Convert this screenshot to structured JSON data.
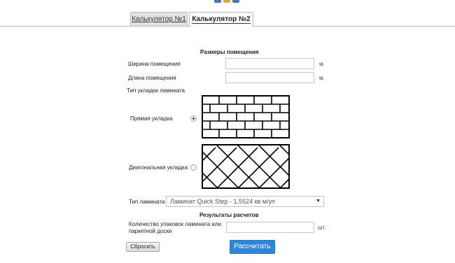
{
  "colors": {
    "accent": "#2d86d8",
    "tab_inactive": "#e3e3e3",
    "border": "#b9b9b9"
  },
  "tabs": [
    {
      "label": "Калькулятор №1",
      "active": false
    },
    {
      "label": "Калькулятор №2",
      "active": true
    }
  ],
  "room": {
    "title": "Размеры помещения",
    "width_label": "Ширина помещения",
    "width_value": "",
    "length_label": "Длина помещения",
    "length_value": "",
    "unit": "м."
  },
  "layout_type": {
    "title": "Тип укладки ламината",
    "options": [
      {
        "label": "Прямая укладка",
        "selected": true,
        "pattern": "brick"
      },
      {
        "label": "Диагональная укладка",
        "selected": false,
        "pattern": "herringbone"
      }
    ]
  },
  "laminate": {
    "label": "Тип ламината",
    "selected": "Ламинат Quick Step - 1,5524 кв м/уп",
    "arrow_icon": "triangle-down"
  },
  "results": {
    "title": "Результаты расчетов",
    "packs_label": "Количество упаковок ламината или паркетной доски",
    "packs_value": "",
    "unit": "шт."
  },
  "buttons": {
    "reset": "Сбросить",
    "calculate": "Рассчитать"
  }
}
